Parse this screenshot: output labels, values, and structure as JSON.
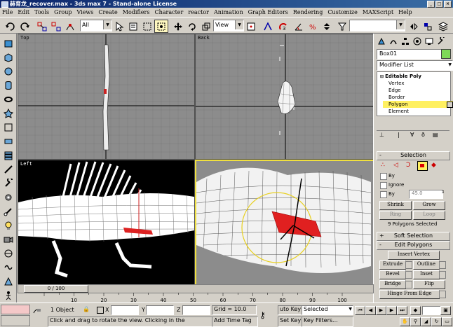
{
  "window": {
    "title": "赫育龙_recover.max - 3ds max 7  - Stand-alone License"
  },
  "menu": [
    "File",
    "Edit",
    "Tools",
    "Group",
    "Views",
    "Create",
    "Modifiers",
    "Character",
    "reactor",
    "Animation",
    "Graph Editors",
    "Rendering",
    "Customize",
    "MAXScript",
    "Help"
  ],
  "toolbar": {
    "selection_filter": "All",
    "reference_coord": "View"
  },
  "viewports": {
    "top": "Top",
    "back": "Back",
    "left": "Left",
    "perspective": ""
  },
  "command_panel": {
    "object_name": "Box01",
    "object_color": "#7ed957",
    "modifier_list": "Modifier List",
    "stack": {
      "root": "Editable Poly",
      "items": [
        "Vertex",
        "Edge",
        "Border",
        "Polygon",
        "Element"
      ],
      "selected": "Polygon"
    },
    "selection": {
      "title": "Selection",
      "by_vertex": "By",
      "ignore_backfacing": "Ignore",
      "by_angle": "By",
      "angle_value": "45.0",
      "shrink": "Shrink",
      "grow": "Grow",
      "ring": "Ring",
      "loop": "Loop",
      "status": "9 Polygons Selected"
    },
    "soft_selection": "Soft Selection",
    "edit_polygons": {
      "title": "Edit Polygons",
      "insert_vertex": "Insert Vertex",
      "extrude": "Extrude",
      "outline": "Outline",
      "bevel": "Bevel",
      "inset": "Inset",
      "bridge": "Bridge",
      "flip": "Flip",
      "hinge": "Hinge From Edge"
    }
  },
  "timeline": {
    "frame_display": "0 / 100",
    "ticks": [
      "10",
      "20",
      "30",
      "40",
      "50",
      "60",
      "70",
      "80",
      "90",
      "100"
    ]
  },
  "status": {
    "selection_info": "1 Object",
    "x_label": "X",
    "y_label": "Y",
    "z_label": "Z",
    "grid": "Grid = 10.0",
    "prompt": "Click and drag to rotate the view.  Clicking in the",
    "add_time_tag": "Add Time Tag",
    "auto_key": "uto Key",
    "set_key": "Set Key",
    "key_mode": "Selected",
    "key_filters": "Key Filters..."
  },
  "colors": {
    "ui_gray": "#d4d0c8",
    "selected_poly": "#e02020",
    "active_viewport_border": "#f0e040",
    "title_bar": "#0a246a"
  }
}
